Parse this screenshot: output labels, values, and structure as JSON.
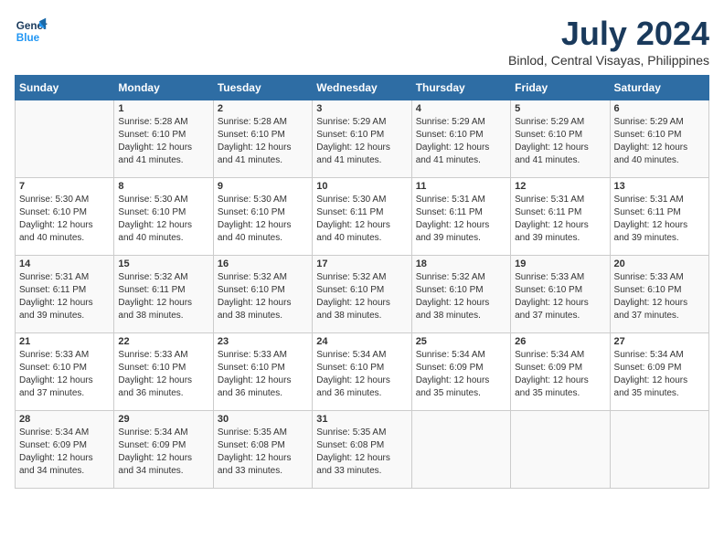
{
  "header": {
    "logo_line1": "General",
    "logo_line2": "Blue",
    "month": "July 2024",
    "location": "Binlod, Central Visayas, Philippines"
  },
  "days_of_week": [
    "Sunday",
    "Monday",
    "Tuesday",
    "Wednesday",
    "Thursday",
    "Friday",
    "Saturday"
  ],
  "weeks": [
    [
      {
        "day": "",
        "sunrise": "",
        "sunset": "",
        "daylight": ""
      },
      {
        "day": "1",
        "sunrise": "Sunrise: 5:28 AM",
        "sunset": "Sunset: 6:10 PM",
        "daylight": "Daylight: 12 hours and 41 minutes."
      },
      {
        "day": "2",
        "sunrise": "Sunrise: 5:28 AM",
        "sunset": "Sunset: 6:10 PM",
        "daylight": "Daylight: 12 hours and 41 minutes."
      },
      {
        "day": "3",
        "sunrise": "Sunrise: 5:29 AM",
        "sunset": "Sunset: 6:10 PM",
        "daylight": "Daylight: 12 hours and 41 minutes."
      },
      {
        "day": "4",
        "sunrise": "Sunrise: 5:29 AM",
        "sunset": "Sunset: 6:10 PM",
        "daylight": "Daylight: 12 hours and 41 minutes."
      },
      {
        "day": "5",
        "sunrise": "Sunrise: 5:29 AM",
        "sunset": "Sunset: 6:10 PM",
        "daylight": "Daylight: 12 hours and 41 minutes."
      },
      {
        "day": "6",
        "sunrise": "Sunrise: 5:29 AM",
        "sunset": "Sunset: 6:10 PM",
        "daylight": "Daylight: 12 hours and 40 minutes."
      }
    ],
    [
      {
        "day": "7",
        "sunrise": "Sunrise: 5:30 AM",
        "sunset": "Sunset: 6:10 PM",
        "daylight": "Daylight: 12 hours and 40 minutes."
      },
      {
        "day": "8",
        "sunrise": "Sunrise: 5:30 AM",
        "sunset": "Sunset: 6:10 PM",
        "daylight": "Daylight: 12 hours and 40 minutes."
      },
      {
        "day": "9",
        "sunrise": "Sunrise: 5:30 AM",
        "sunset": "Sunset: 6:10 PM",
        "daylight": "Daylight: 12 hours and 40 minutes."
      },
      {
        "day": "10",
        "sunrise": "Sunrise: 5:30 AM",
        "sunset": "Sunset: 6:11 PM",
        "daylight": "Daylight: 12 hours and 40 minutes."
      },
      {
        "day": "11",
        "sunrise": "Sunrise: 5:31 AM",
        "sunset": "Sunset: 6:11 PM",
        "daylight": "Daylight: 12 hours and 39 minutes."
      },
      {
        "day": "12",
        "sunrise": "Sunrise: 5:31 AM",
        "sunset": "Sunset: 6:11 PM",
        "daylight": "Daylight: 12 hours and 39 minutes."
      },
      {
        "day": "13",
        "sunrise": "Sunrise: 5:31 AM",
        "sunset": "Sunset: 6:11 PM",
        "daylight": "Daylight: 12 hours and 39 minutes."
      }
    ],
    [
      {
        "day": "14",
        "sunrise": "Sunrise: 5:31 AM",
        "sunset": "Sunset: 6:11 PM",
        "daylight": "Daylight: 12 hours and 39 minutes."
      },
      {
        "day": "15",
        "sunrise": "Sunrise: 5:32 AM",
        "sunset": "Sunset: 6:11 PM",
        "daylight": "Daylight: 12 hours and 38 minutes."
      },
      {
        "day": "16",
        "sunrise": "Sunrise: 5:32 AM",
        "sunset": "Sunset: 6:10 PM",
        "daylight": "Daylight: 12 hours and 38 minutes."
      },
      {
        "day": "17",
        "sunrise": "Sunrise: 5:32 AM",
        "sunset": "Sunset: 6:10 PM",
        "daylight": "Daylight: 12 hours and 38 minutes."
      },
      {
        "day": "18",
        "sunrise": "Sunrise: 5:32 AM",
        "sunset": "Sunset: 6:10 PM",
        "daylight": "Daylight: 12 hours and 38 minutes."
      },
      {
        "day": "19",
        "sunrise": "Sunrise: 5:33 AM",
        "sunset": "Sunset: 6:10 PM",
        "daylight": "Daylight: 12 hours and 37 minutes."
      },
      {
        "day": "20",
        "sunrise": "Sunrise: 5:33 AM",
        "sunset": "Sunset: 6:10 PM",
        "daylight": "Daylight: 12 hours and 37 minutes."
      }
    ],
    [
      {
        "day": "21",
        "sunrise": "Sunrise: 5:33 AM",
        "sunset": "Sunset: 6:10 PM",
        "daylight": "Daylight: 12 hours and 37 minutes."
      },
      {
        "day": "22",
        "sunrise": "Sunrise: 5:33 AM",
        "sunset": "Sunset: 6:10 PM",
        "daylight": "Daylight: 12 hours and 36 minutes."
      },
      {
        "day": "23",
        "sunrise": "Sunrise: 5:33 AM",
        "sunset": "Sunset: 6:10 PM",
        "daylight": "Daylight: 12 hours and 36 minutes."
      },
      {
        "day": "24",
        "sunrise": "Sunrise: 5:34 AM",
        "sunset": "Sunset: 6:10 PM",
        "daylight": "Daylight: 12 hours and 36 minutes."
      },
      {
        "day": "25",
        "sunrise": "Sunrise: 5:34 AM",
        "sunset": "Sunset: 6:09 PM",
        "daylight": "Daylight: 12 hours and 35 minutes."
      },
      {
        "day": "26",
        "sunrise": "Sunrise: 5:34 AM",
        "sunset": "Sunset: 6:09 PM",
        "daylight": "Daylight: 12 hours and 35 minutes."
      },
      {
        "day": "27",
        "sunrise": "Sunrise: 5:34 AM",
        "sunset": "Sunset: 6:09 PM",
        "daylight": "Daylight: 12 hours and 35 minutes."
      }
    ],
    [
      {
        "day": "28",
        "sunrise": "Sunrise: 5:34 AM",
        "sunset": "Sunset: 6:09 PM",
        "daylight": "Daylight: 12 hours and 34 minutes."
      },
      {
        "day": "29",
        "sunrise": "Sunrise: 5:34 AM",
        "sunset": "Sunset: 6:09 PM",
        "daylight": "Daylight: 12 hours and 34 minutes."
      },
      {
        "day": "30",
        "sunrise": "Sunrise: 5:35 AM",
        "sunset": "Sunset: 6:08 PM",
        "daylight": "Daylight: 12 hours and 33 minutes."
      },
      {
        "day": "31",
        "sunrise": "Sunrise: 5:35 AM",
        "sunset": "Sunset: 6:08 PM",
        "daylight": "Daylight: 12 hours and 33 minutes."
      },
      {
        "day": "",
        "sunrise": "",
        "sunset": "",
        "daylight": ""
      },
      {
        "day": "",
        "sunrise": "",
        "sunset": "",
        "daylight": ""
      },
      {
        "day": "",
        "sunrise": "",
        "sunset": "",
        "daylight": ""
      }
    ]
  ]
}
